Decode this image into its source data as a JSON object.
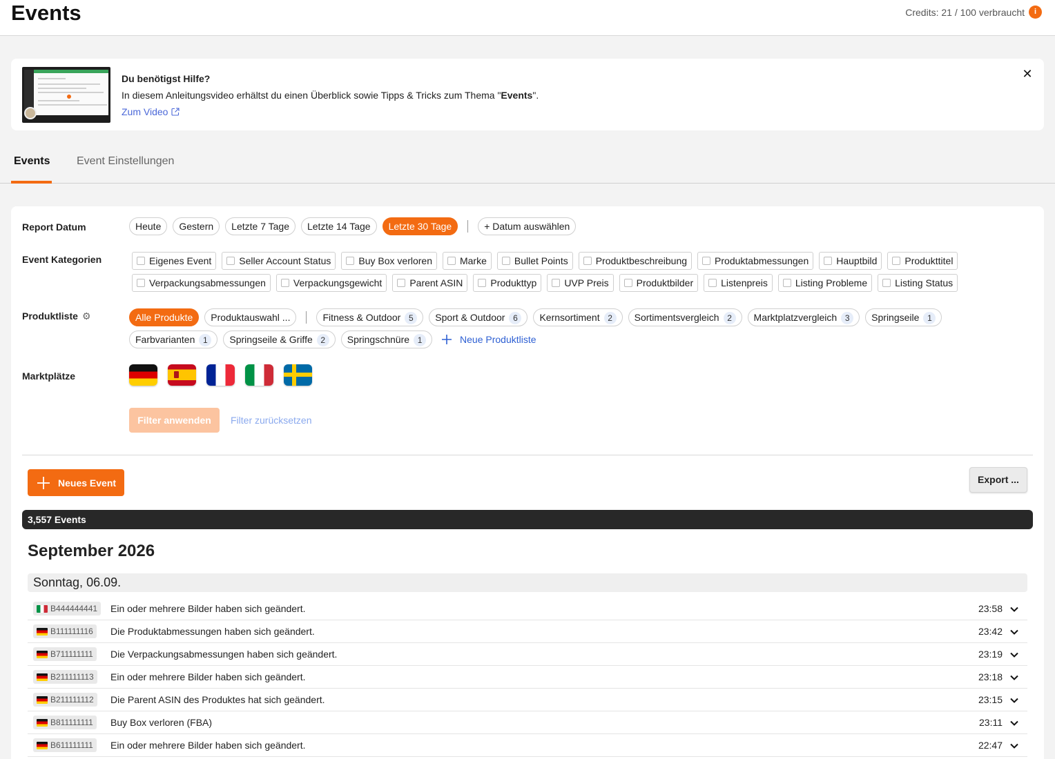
{
  "header": {
    "title": "Events",
    "credits": "Credits: 21 / 100 verbraucht",
    "credits_icon": "i"
  },
  "help": {
    "title": "Du benötigst Hilfe?",
    "text_before": "In diesem Anleitungsvideo erhältst du einen Überblick sowie Tipps & Tricks zum Thema \"",
    "text_bold": "Events",
    "text_after": "\".",
    "link": "Zum Video",
    "close": "✕"
  },
  "tabs": [
    {
      "label": "Events",
      "active": true
    },
    {
      "label": "Event Einstellungen",
      "active": false
    }
  ],
  "filters": {
    "report_date": {
      "label": "Report Datum",
      "options": [
        "Heute",
        "Gestern",
        "Letzte 7 Tage",
        "Letzte 14 Tage",
        "Letzte 30 Tage"
      ],
      "active": "Letzte 30 Tage",
      "custom": "+ Datum auswählen"
    },
    "categories": {
      "label": "Event Kategorien",
      "row1": [
        "Eigenes Event",
        "Seller Account Status",
        "Buy Box verloren",
        "Marke",
        "Bullet Points",
        "Produktbeschreibung",
        "Produktabmessungen",
        "Hauptbild",
        "Produkttitel"
      ],
      "row2": [
        "Verpackungsabmessungen",
        "Verpackungsgewicht",
        "Parent ASIN",
        "Produkttyp",
        "UVP Preis",
        "Produktbilder",
        "Listenpreis",
        "Listing Probleme",
        "Listing Status"
      ]
    },
    "product_list": {
      "label": "Produktliste",
      "all": "Alle Produkte",
      "selection": "Produktauswahl ...",
      "row1": [
        {
          "name": "Fitness & Outdoor",
          "count": "5"
        },
        {
          "name": "Sport & Outdoor",
          "count": "6"
        },
        {
          "name": "Kernsortiment",
          "count": "2"
        },
        {
          "name": "Sortimentsvergleich",
          "count": "2"
        },
        {
          "name": "Marktplatzvergleich",
          "count": "3"
        },
        {
          "name": "Springseile",
          "count": "1"
        }
      ],
      "row2": [
        {
          "name": "Farbvarianten",
          "count": "1"
        },
        {
          "name": "Springseile & Griffe",
          "count": "2"
        },
        {
          "name": "Springschnüre",
          "count": "1"
        }
      ],
      "new_list": "Neue Produktliste"
    },
    "marketplaces": {
      "label": "Marktplätze",
      "flags": [
        "de",
        "es",
        "fr",
        "it",
        "se"
      ]
    },
    "apply": "Filter anwenden",
    "reset": "Filter zurücksetzen"
  },
  "actions": {
    "new_event": "Neues Event",
    "export": "Export ..."
  },
  "event_count": "3,557 Events",
  "month": "September 2026",
  "day": "Sonntag, 06.09.",
  "events": [
    {
      "flag": "it",
      "asin": "B444444441",
      "text": "Ein oder mehrere Bilder haben sich geändert.",
      "time": "23:58"
    },
    {
      "flag": "de",
      "asin": "B111111116",
      "text": "Die Produktabmessungen haben sich geändert.",
      "time": "23:42"
    },
    {
      "flag": "de",
      "asin": "B711111111",
      "text": "Die Verpackungsabmessungen haben sich geändert.",
      "time": "23:19"
    },
    {
      "flag": "de",
      "asin": "B211111113",
      "text": "Ein oder mehrere Bilder haben sich geändert.",
      "time": "23:18"
    },
    {
      "flag": "de",
      "asin": "B211111112",
      "text": "Die Parent ASIN des Produktes hat sich geändert.",
      "time": "23:15"
    },
    {
      "flag": "de",
      "asin": "B811111111",
      "text": "Buy Box verloren (FBA)",
      "time": "23:11"
    },
    {
      "flag": "de",
      "asin": "B611111111",
      "text": "Ein oder mehrere Bilder haben sich geändert.",
      "time": "22:47"
    }
  ],
  "colors": {
    "accent": "#f36b12",
    "link": "#2d5fd3",
    "count_bar": "#282828"
  }
}
